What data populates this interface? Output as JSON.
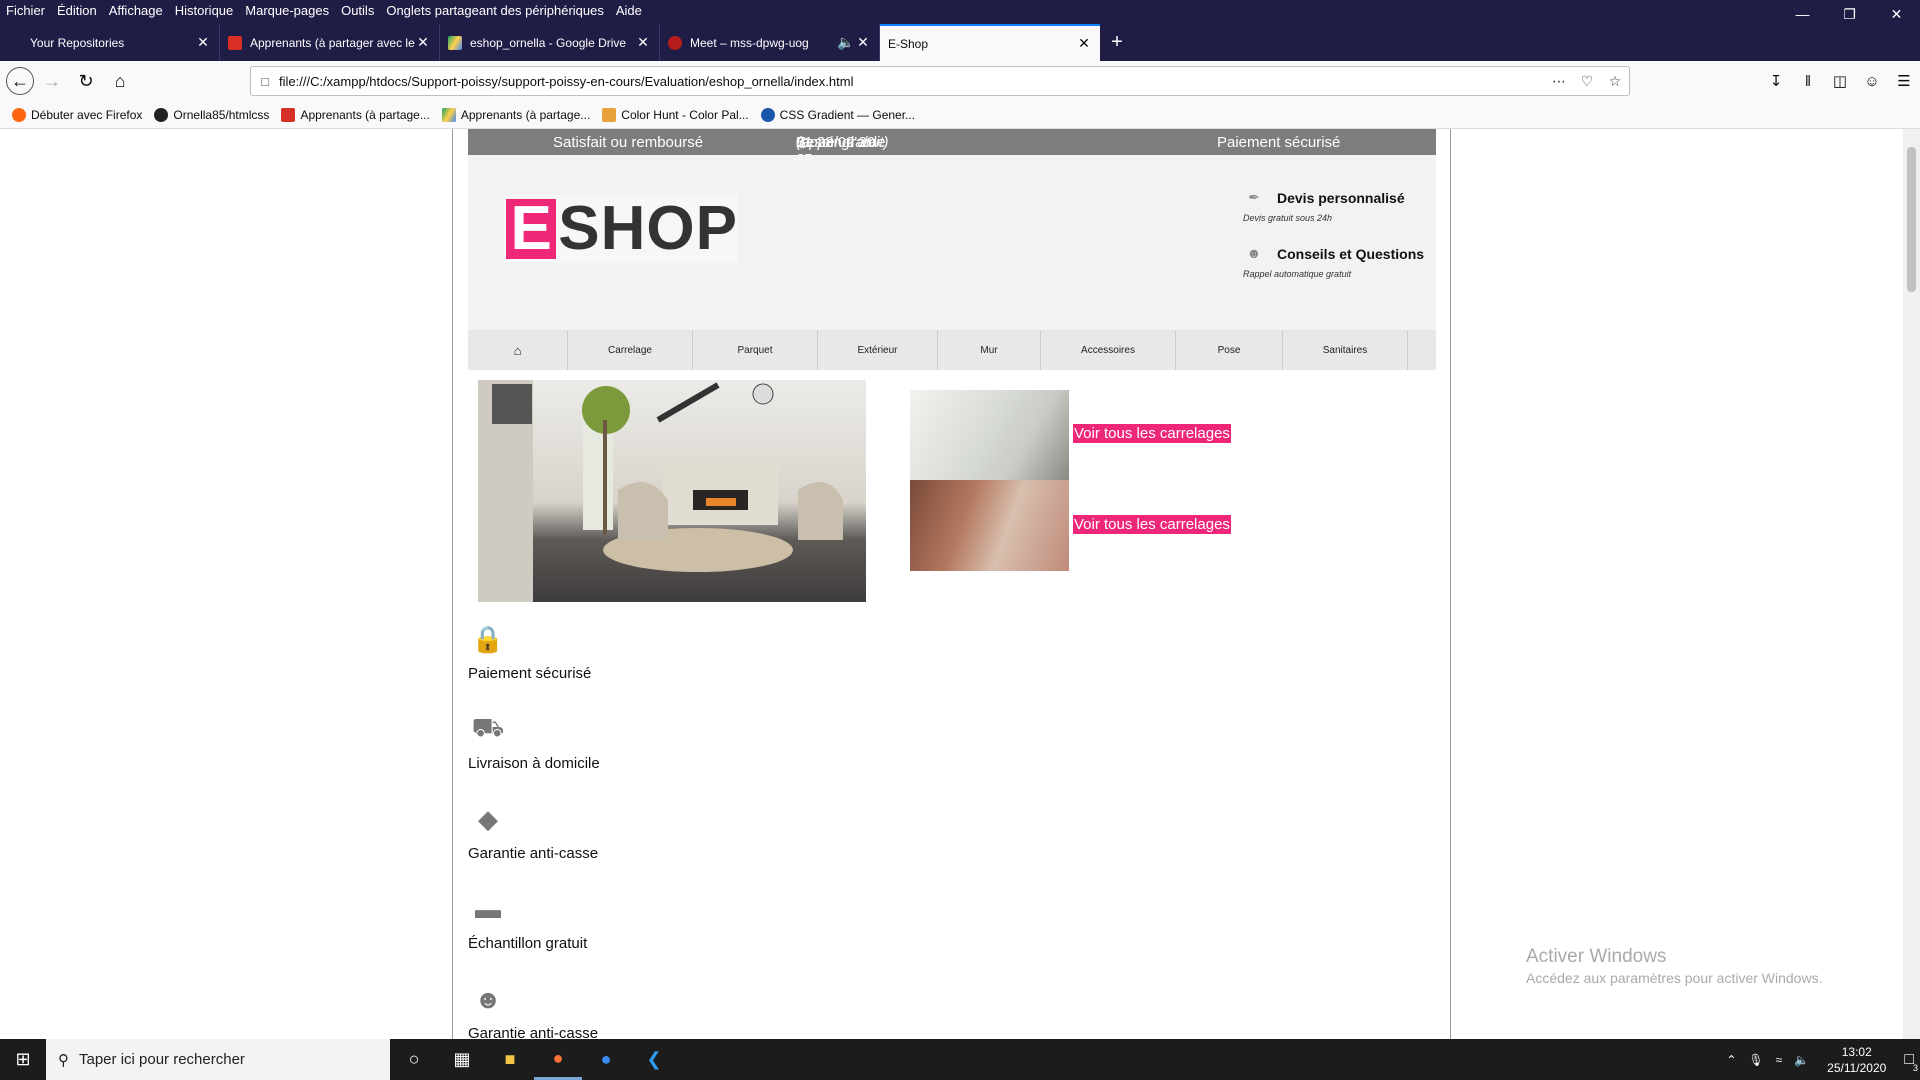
{
  "menu": [
    "Fichier",
    "Édition",
    "Affichage",
    "Historique",
    "Marque-pages",
    "Outils",
    "Onglets partageant des périphériques",
    "Aide"
  ],
  "tabs": [
    {
      "title": "Your Repositories",
      "color": "#ffffff"
    },
    {
      "title": "Apprenants (à partager avec le",
      "color": "#d93025"
    },
    {
      "title": "eshop_ornella - Google Drive",
      "color": "#1fa463"
    },
    {
      "title": "Meet – mss-dpwg-uog",
      "color": "#b71c1c"
    },
    {
      "title": "E-Shop",
      "color": "#f9f9fb"
    }
  ],
  "url": "file:///C:/xampp/htdocs/Support-poissy/support-poissy-en-cours/Evaluation/eshop_ornella/index.html",
  "bookmarks": [
    {
      "label": "Débuter avec Firefox",
      "color": "#ff6611"
    },
    {
      "label": "Ornella85/htmlcss",
      "color": "#222222"
    },
    {
      "label": "Apprenants (à partage...",
      "color": "#d93025"
    },
    {
      "label": "Apprenants (à partage...",
      "color": "#1fa463"
    },
    {
      "label": "Color Hunt - Color Pal...",
      "color": "#e8a23a"
    },
    {
      "label": "CSS Gradient — Gener...",
      "color": "#1a56a8"
    }
  ],
  "site": {
    "topstrip": {
      "satisfied": "Satisfait ou remboursé",
      "help": "Besoin d'aide ?",
      "phone": "01 28 02 29 45",
      "phone_note": "(appel gratuit)",
      "payment": "Paiement sécurisé"
    },
    "logo": {
      "e": "E",
      "shop": "SHOP"
    },
    "quote": {
      "title": "Devis personnalisé",
      "sub": "Devis gratuit sous 24h"
    },
    "advice": {
      "title": "Conseils et Questions",
      "sub": "Rappel automatique gratuit"
    },
    "nav": [
      "Carrelage",
      "Parquet",
      "Extérieur",
      "Mur",
      "Accessoires",
      "Pose",
      "Sanitaires"
    ],
    "links": [
      "Voir tous les carrelages",
      "Voir tous les carrelages"
    ],
    "features": [
      "Paiement sécurisé",
      "Livraison à domicile",
      "Garantie anti-casse",
      "Échantillon gratuit",
      "Garantie anti-casse"
    ],
    "accent": "#ee2778"
  },
  "watermark": {
    "title": "Activer Windows",
    "sub": "Accédez aux paramètres pour activer Windows."
  },
  "taskbar": {
    "search": "Taper ici pour rechercher",
    "time": "13:02",
    "date": "25/11/2020",
    "notifications": "3"
  }
}
